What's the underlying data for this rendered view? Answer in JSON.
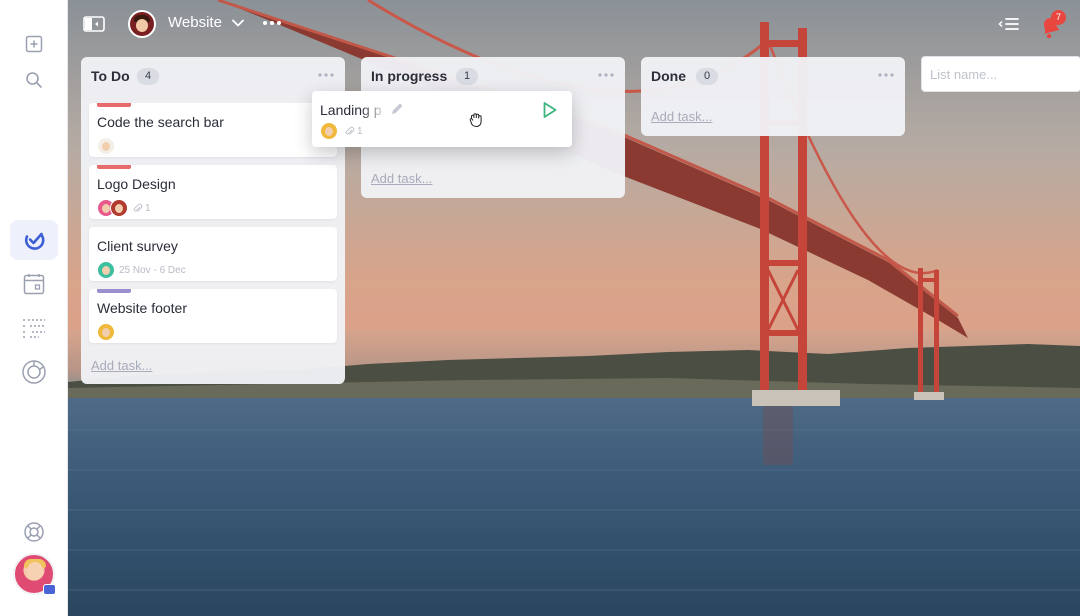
{
  "colors": {
    "accent": "#3d5fd6",
    "stripe_red": "#e86b6b",
    "stripe_purple": "#9b8fd0",
    "badge_red": "#e8473f",
    "play_green": "#3db67f"
  },
  "sidebar": {
    "items": [
      {
        "name": "new-task-icon",
        "active": false
      },
      {
        "name": "search-icon",
        "active": false
      },
      {
        "name": "tasks-icon",
        "active": true
      },
      {
        "name": "calendar-icon",
        "active": false
      },
      {
        "name": "list-view-icon",
        "active": false
      },
      {
        "name": "reports-icon",
        "active": false
      },
      {
        "name": "help-icon",
        "active": false
      }
    ]
  },
  "header": {
    "project_title": "Website",
    "notifications_count": "7"
  },
  "lists": [
    {
      "title": "To Do",
      "count": "4",
      "add_task": "Add task...",
      "cards": [
        {
          "title": "Code the search bar",
          "stripe": "#e86b6b"
        },
        {
          "title": "Logo Design",
          "stripe": "#e86b6b",
          "attachments": "1"
        },
        {
          "title": "Client survey",
          "dates": "25 Nov - 6 Dec"
        },
        {
          "title": "Website footer",
          "stripe": "#9b8fd0"
        }
      ]
    },
    {
      "title": "In progress",
      "count": "1",
      "add_task": "Add task...",
      "cards": []
    },
    {
      "title": "Done",
      "count": "0",
      "add_task": "Add task...",
      "cards": []
    }
  ],
  "new_list": {
    "placeholder": "List name..."
  },
  "dragged_card": {
    "title": "Landing p",
    "attachments": "1"
  }
}
